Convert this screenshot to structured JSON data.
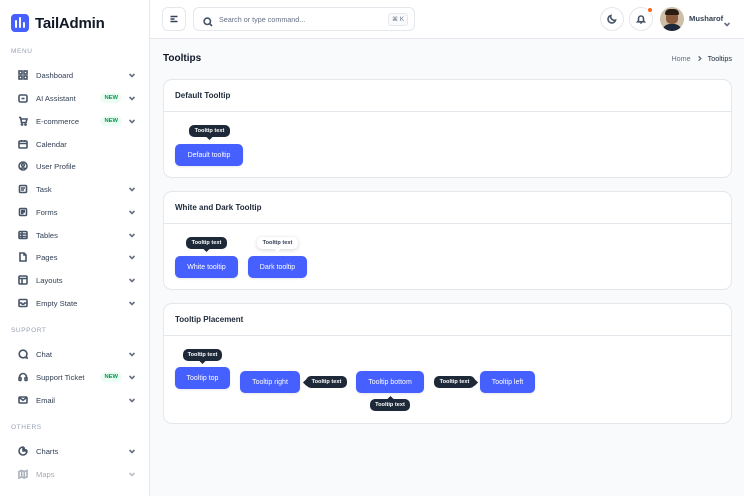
{
  "brand": {
    "name": "TailAdmin"
  },
  "sidebar": {
    "sections": [
      "Menu",
      "Support",
      "Others"
    ],
    "items": [
      {
        "label": "Dashboard",
        "badge": "",
        "chevron": true
      },
      {
        "label": "AI Assistant",
        "badge": "NEW",
        "chevron": true
      },
      {
        "label": "E-commerce",
        "badge": "NEW",
        "chevron": true
      },
      {
        "label": "Calendar",
        "badge": "",
        "chevron": false
      },
      {
        "label": "User Profile",
        "badge": "",
        "chevron": false
      },
      {
        "label": "Task",
        "badge": "",
        "chevron": true
      },
      {
        "label": "Forms",
        "badge": "",
        "chevron": true
      },
      {
        "label": "Tables",
        "badge": "",
        "chevron": true
      },
      {
        "label": "Pages",
        "badge": "",
        "chevron": true
      },
      {
        "label": "Layouts",
        "badge": "",
        "chevron": true
      },
      {
        "label": "Empty State",
        "badge": "",
        "chevron": true
      },
      {
        "label": "Chat",
        "badge": "",
        "chevron": true
      },
      {
        "label": "Support Ticket",
        "badge": "NEW",
        "chevron": true
      },
      {
        "label": "Email",
        "badge": "",
        "chevron": true
      },
      {
        "label": "Charts",
        "badge": "",
        "chevron": true
      },
      {
        "label": "Maps",
        "badge": "",
        "chevron": true
      }
    ]
  },
  "header": {
    "search_placeholder": "Search or type command...",
    "search_shortcut": "⌘ K",
    "user_name": "Musharof"
  },
  "page": {
    "title": "Tooltips",
    "breadcrumb": {
      "home": "Home",
      "current": "Tooltips"
    }
  },
  "cards": {
    "default": {
      "title": "Default Tooltip",
      "button": "Default tooltip",
      "tooltip": "Tooltip text"
    },
    "white_dark": {
      "title": "White and Dark Tooltip",
      "white_button": "White tooltip",
      "white_tooltip": "Tooltip text",
      "dark_button": "Dark tooltip",
      "dark_tooltip": "Tooltip text"
    },
    "placement": {
      "title": "Tooltip Placement",
      "top_button": "Tooltip top",
      "top_tooltip": "Tooltip text",
      "right_button": "Tooltip right",
      "right_tooltip": "Tooltip text",
      "bottom_button": "Tooltip bottom",
      "bottom_tooltip": "Tooltip text",
      "left_button": "Tooltip left",
      "left_tooltip": "Tooltip text"
    }
  },
  "colors": {
    "primary": "#465fff",
    "tooltip_dark": "#1d2939",
    "badge_green": "#039855",
    "notification": "#fb6514"
  }
}
